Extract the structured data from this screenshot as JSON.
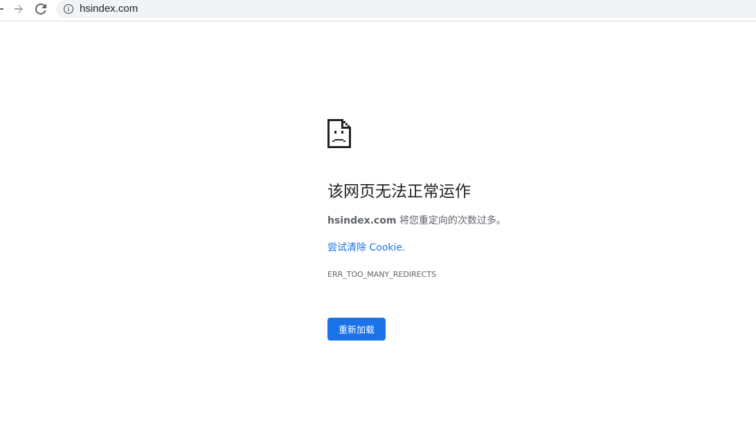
{
  "browser": {
    "url": "hsindex.com",
    "icons": {
      "back": "arrow-back-icon",
      "forward": "arrow-forward-icon",
      "reload": "reload-icon",
      "site_info": "info-icon"
    }
  },
  "error": {
    "icon": "sad-page-icon",
    "title": "该网页无法正常运作",
    "host": "hsindex.com",
    "message": " 将您重定向的次数过多。",
    "suggestion_link": "尝试清除 Cookie.",
    "code": "ERR_TOO_MANY_REDIRECTS",
    "reload_label": "重新加载"
  },
  "colors": {
    "accent": "#1a73e8",
    "text_secondary": "#5f6368",
    "text_primary": "#202124",
    "omnibox_bg": "#f1f3f4"
  }
}
